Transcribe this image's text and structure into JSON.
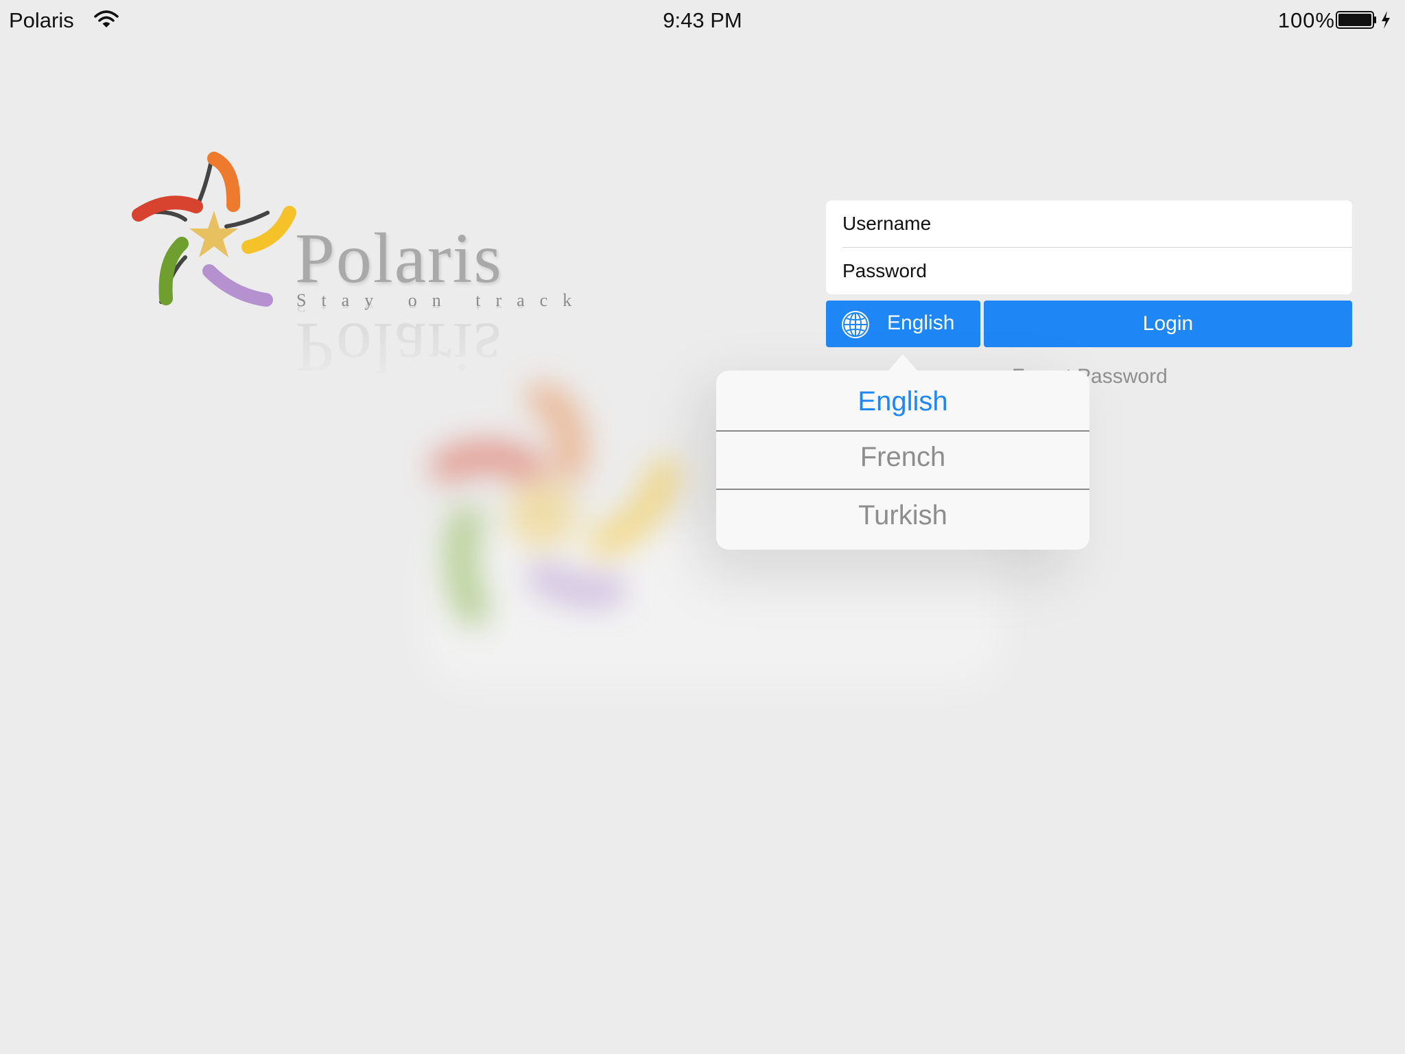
{
  "status_bar": {
    "carrier": "Polaris",
    "time": "9:43 PM",
    "battery_percent": "100%"
  },
  "logo": {
    "wordmark": "Polaris",
    "tagline": "Stay on track"
  },
  "login_form": {
    "username_placeholder": "Username",
    "password_placeholder": "Password",
    "language_button_label": "English",
    "login_button_label": "Login",
    "forgot_password_label": "Forgot Password"
  },
  "language_picker": {
    "options": [
      "English",
      "French",
      "Turkish"
    ],
    "selected": "English"
  },
  "colors": {
    "accent": "#1f87f5",
    "background": "#ececec",
    "muted_text": "#8d8d8d"
  },
  "icons": [
    "wifi-icon",
    "battery-icon",
    "charging-icon",
    "globe-icon",
    "polaris-star-logo"
  ]
}
